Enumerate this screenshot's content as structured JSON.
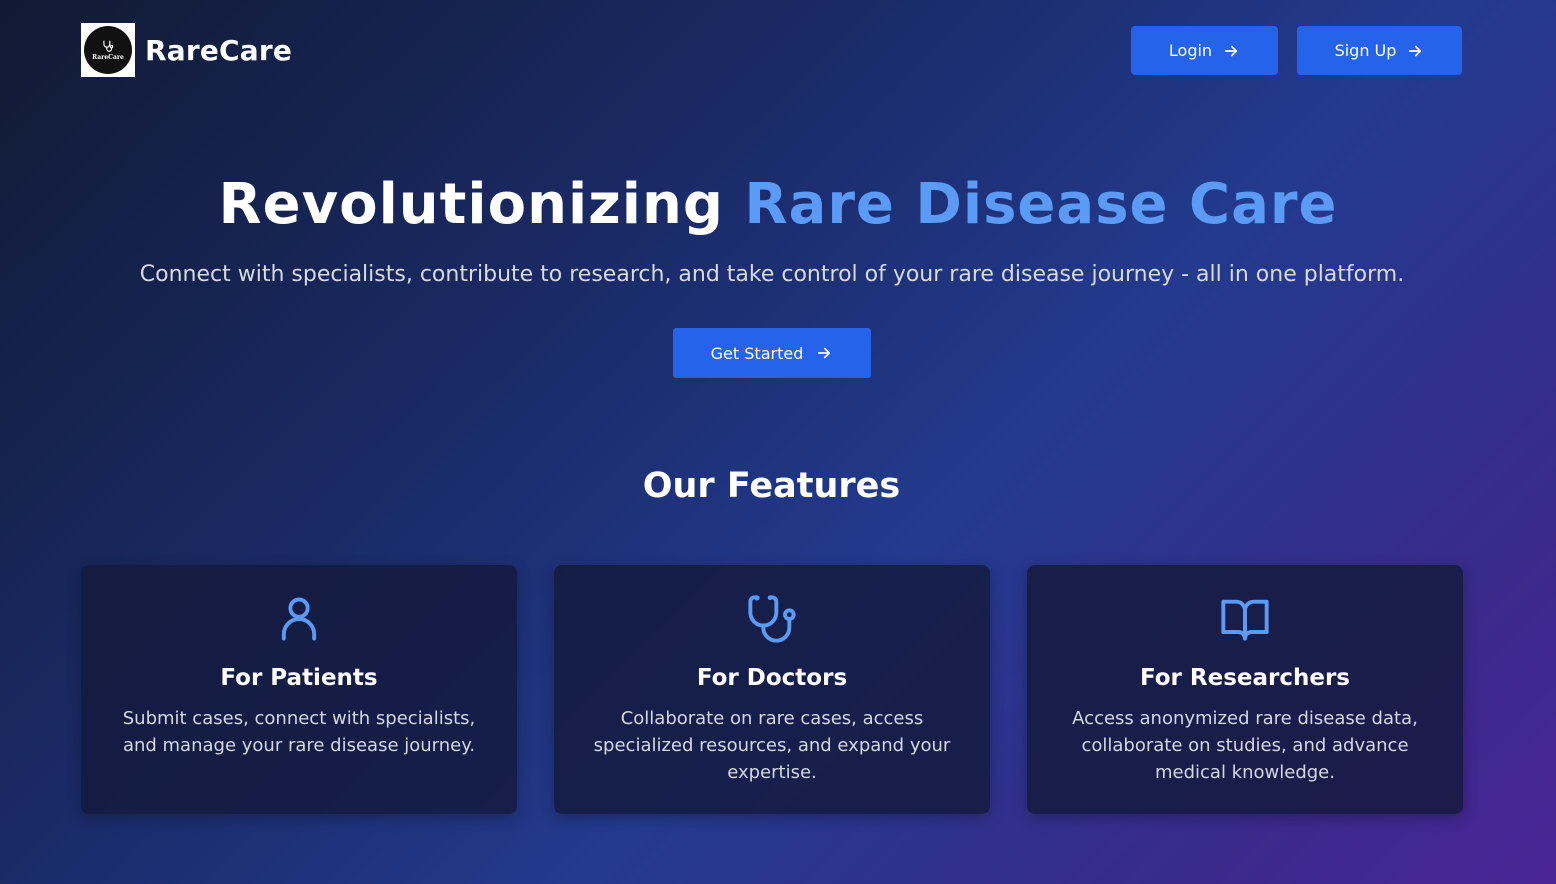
{
  "brand": {
    "logo_text": "RareCare",
    "name": "RareCare"
  },
  "nav": {
    "login_label": "Login",
    "signup_label": "Sign Up"
  },
  "hero": {
    "title_main": "Revolutionizing ",
    "title_accent": "Rare Disease Care",
    "subtitle": "Connect with specialists, contribute to research, and take control of your rare disease journey - all in one platform.",
    "cta_label": "Get Started"
  },
  "features": {
    "heading": "Our Features",
    "cards": [
      {
        "icon": "user-icon",
        "title": "For Patients",
        "description": "Submit cases, connect with specialists, and manage your rare disease journey."
      },
      {
        "icon": "stethoscope-icon",
        "title": "For Doctors",
        "description": "Collaborate on rare cases, access specialized resources, and expand your expertise."
      },
      {
        "icon": "book-open-icon",
        "title": "For Researchers",
        "description": "Access anonymized rare disease data, collaborate on studies, and advance medical knowledge."
      }
    ]
  },
  "colors": {
    "accent": "#5b9bf5",
    "button": "#2563eb",
    "card_bg": "#141a3c"
  }
}
